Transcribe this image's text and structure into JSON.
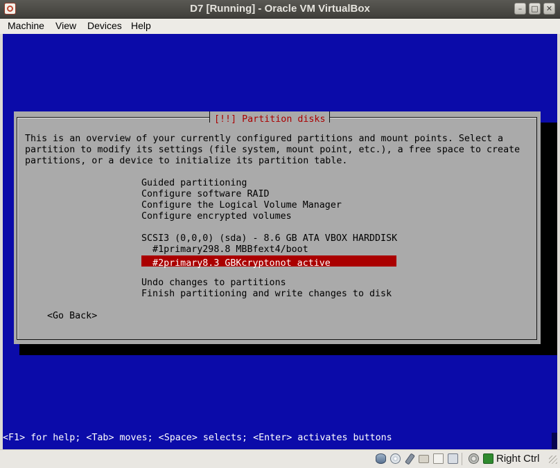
{
  "window": {
    "title": "D7 [Running] - Oracle VM VirtualBox",
    "icons": [
      "virtualbox-app-icon",
      "minimize-icon",
      "maximize-icon",
      "close-icon"
    ]
  },
  "menu": {
    "items": [
      "Machine",
      "View",
      "Devices",
      "Help"
    ]
  },
  "dialog": {
    "title": "[!!] Partition disks",
    "intro": [
      "This is an overview of your currently configured partitions and mount points. Select a",
      "partition to modify its settings (file system, mount point, etc.), a free space to create",
      "partitions, or a device to initialize its partition table."
    ],
    "options": [
      "Guided partitioning",
      "Configure software RAID",
      "Configure the Logical Volume Manager",
      "Configure encrypted volumes"
    ],
    "disk": "SCSI3 (0,0,0) (sda) - 8.6 GB ATA VBOX HARDDISK",
    "partitions": [
      "  #1primary298.8 MBBfext4/boot",
      "  #2primary8.3 GBKcryptonot active"
    ],
    "selected_index": 1,
    "actions": [
      "Undo changes to partitions",
      "Finish partitioning and write changes to disk"
    ],
    "go_back": "<Go Back>"
  },
  "help_bar": "<F1> for help; <Tab> moves; <Space> selects; <Enter> activates buttons",
  "statusbar": {
    "host_key": "Right Ctrl",
    "icons": [
      "hard-disk-icon",
      "optical-drive-icon",
      "usb-icon",
      "shared-folders-icon",
      "shared-clipboard-icon",
      "display-icon",
      "network-icon",
      "mouse-integration-icon"
    ]
  },
  "colors": {
    "guest_background": "#0b0ba9",
    "dialog_background": "#aaaaaa",
    "dialog_title": "#aa0000",
    "selection": "#aa0000"
  }
}
